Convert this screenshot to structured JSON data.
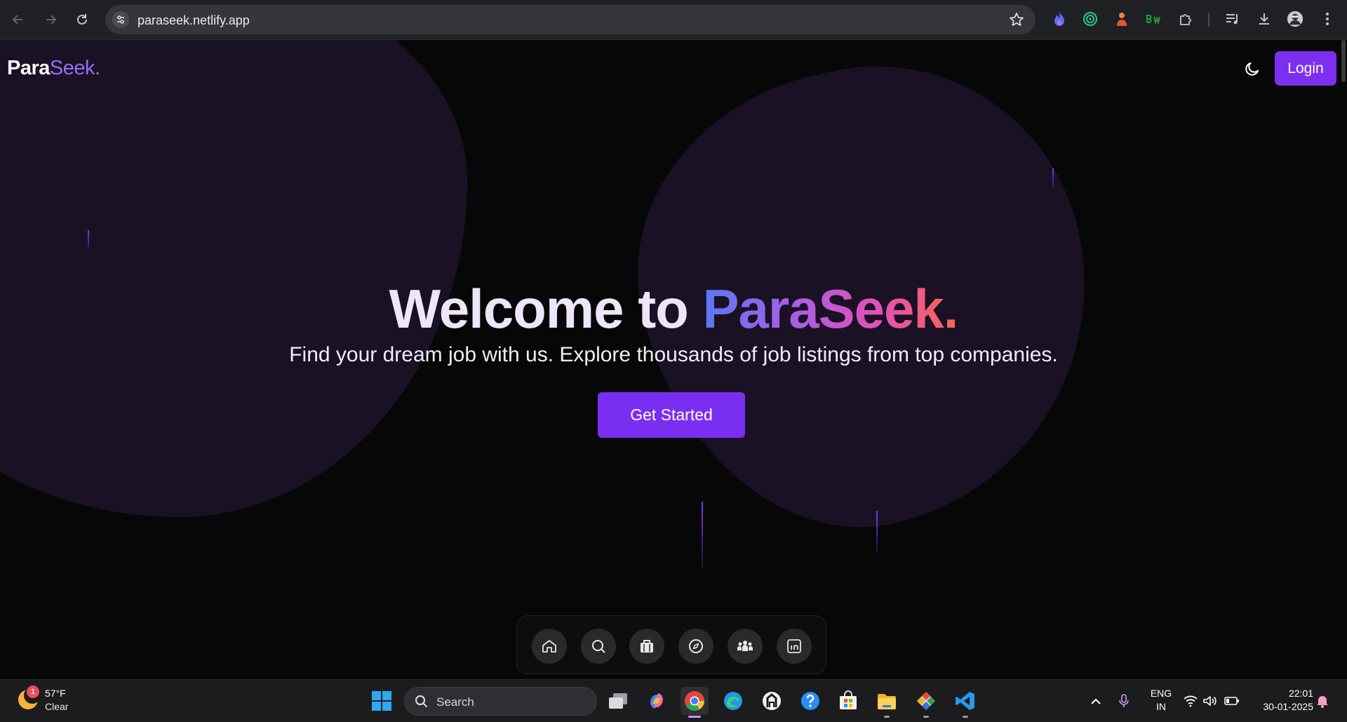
{
  "browser": {
    "url": "paraseek.netlify.app"
  },
  "site": {
    "brand_main": "Para",
    "brand_accent": "Seek.",
    "login_label": "Login"
  },
  "hero": {
    "title_prefix": "Welcome to ",
    "title_brand": "ParaSeek.",
    "subtitle": "Find your dream job with us. Explore thousands of job listings from top companies.",
    "cta_label": "Get Started"
  },
  "dock": {
    "items": [
      "home-icon",
      "search-icon",
      "briefcase-icon",
      "compass-icon",
      "people-icon",
      "linkedin-icon"
    ]
  },
  "taskbar": {
    "weather_temp": "57°F",
    "weather_condition": "Clear",
    "weather_badge": "1",
    "search_label": "Search",
    "lang_line1": "ENG",
    "lang_line2": "IN",
    "time": "22:01",
    "date": "30-01-2025"
  },
  "colors": {
    "accent": "#7c2ff0",
    "background": "#070707",
    "blob": "#1a1224"
  }
}
